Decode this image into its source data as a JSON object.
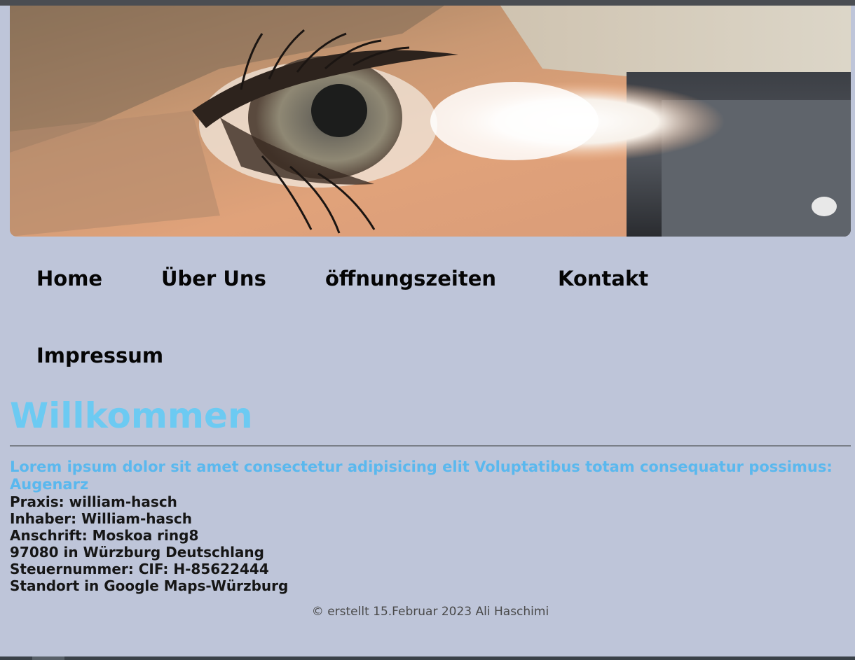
{
  "hero": {
    "image_name": "eye-examination-photo"
  },
  "nav": {
    "items": [
      {
        "label": "Home"
      },
      {
        "label": "Über Uns"
      },
      {
        "label": "öffnungszeiten"
      },
      {
        "label": "Kontakt"
      },
      {
        "label": "Impressum"
      }
    ]
  },
  "main": {
    "title": "Willkommen",
    "intro": "Lorem ipsum dolor sit amet consectetur adipisicing elit Voluptatibus totam consequatur possimus: Augenarz",
    "info": [
      "Praxis: william-hasch",
      "Inhaber: William-hasch",
      "Anschrift: Moskoa ring8",
      "97080 in Würzburg Deutschlang",
      "Steuernummer: CIF: H-85622444",
      "Standort in Google Maps-Würzburg"
    ]
  },
  "footer": {
    "text": "© erstellt 15.Februar 2023 Ali Haschimi"
  },
  "colors": {
    "background": "#bec5d9",
    "heading": "#6ccaf2",
    "intro": "#5ab8ee",
    "text": "#161616"
  }
}
